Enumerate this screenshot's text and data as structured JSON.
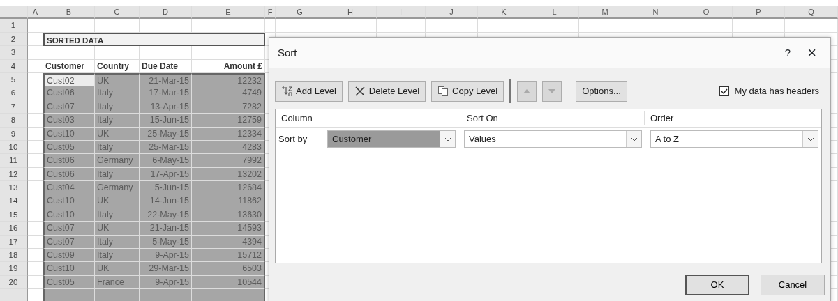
{
  "sheet": {
    "column_headers": [
      "A",
      "B",
      "C",
      "D",
      "E",
      "F",
      "G",
      "H",
      "I",
      "J",
      "K",
      "L",
      "M",
      "N",
      "O",
      "P",
      "Q"
    ],
    "row_numbers": [
      "1",
      "2",
      "3",
      "4",
      "5",
      "6",
      "7",
      "8",
      "9",
      "10",
      "11",
      "12",
      "13",
      "14",
      "15",
      "16",
      "17",
      "18",
      "19",
      "20"
    ],
    "title": "SORTED DATA",
    "table_headers": [
      "Customer",
      "Country",
      "Due Date",
      "Amount £"
    ],
    "rows": [
      {
        "customer": "Cust02",
        "country": "UK",
        "due_date": "21-Mar-15",
        "amount": "12232",
        "selected": true,
        "active": true
      },
      {
        "customer": "Cust06",
        "country": "Italy",
        "due_date": "17-Mar-15",
        "amount": "4749",
        "selected": true,
        "active": false
      },
      {
        "customer": "Cust07",
        "country": "Italy",
        "due_date": "13-Apr-15",
        "amount": "7282",
        "selected": true,
        "active": false
      },
      {
        "customer": "Cust03",
        "country": "Italy",
        "due_date": "15-Jun-15",
        "amount": "12759",
        "selected": true,
        "active": false
      },
      {
        "customer": "Cust10",
        "country": "UK",
        "due_date": "25-May-15",
        "amount": "12334",
        "selected": true,
        "active": false
      },
      {
        "customer": "Cust05",
        "country": "Italy",
        "due_date": "25-Mar-15",
        "amount": "4283",
        "selected": true,
        "active": false
      },
      {
        "customer": "Cust06",
        "country": "Germany",
        "due_date": "6-May-15",
        "amount": "7992",
        "selected": true,
        "active": false
      },
      {
        "customer": "Cust06",
        "country": "Italy",
        "due_date": "17-Apr-15",
        "amount": "13202",
        "selected": true,
        "active": false
      },
      {
        "customer": "Cust04",
        "country": "Germany",
        "due_date": "5-Jun-15",
        "amount": "12684",
        "selected": true,
        "active": false
      },
      {
        "customer": "Cust10",
        "country": "UK",
        "due_date": "14-Jun-15",
        "amount": "11862",
        "selected": true,
        "active": false
      },
      {
        "customer": "Cust10",
        "country": "Italy",
        "due_date": "22-May-15",
        "amount": "13630",
        "selected": true,
        "active": false
      },
      {
        "customer": "Cust07",
        "country": "UK",
        "due_date": "21-Jan-15",
        "amount": "14593",
        "selected": true,
        "active": false
      },
      {
        "customer": "Cust07",
        "country": "Italy",
        "due_date": "5-May-15",
        "amount": "4394",
        "selected": true,
        "active": false
      },
      {
        "customer": "Cust09",
        "country": "Italy",
        "due_date": "9-Apr-15",
        "amount": "15712",
        "selected": true,
        "active": false
      },
      {
        "customer": "Cust10",
        "country": "UK",
        "due_date": "29-Mar-15",
        "amount": "6503",
        "selected": true,
        "active": false
      },
      {
        "customer": "Cust05",
        "country": "France",
        "due_date": "9-Apr-15",
        "amount": "10544",
        "selected": true,
        "active": false
      }
    ]
  },
  "dialog": {
    "title": "Sort",
    "help": "?",
    "close": "×",
    "toolbar": [
      {
        "kind": "add",
        "key": "A",
        "post": "dd Level",
        "disabled": false
      },
      {
        "kind": "delete",
        "key": "D",
        "post": "elete Level",
        "disabled": false
      },
      {
        "kind": "copy",
        "key": "C",
        "post": "opy Level",
        "disabled": false
      },
      {
        "kind": "move_up",
        "disabled": true
      },
      {
        "kind": "move_down",
        "disabled": true
      },
      {
        "kind": "options",
        "key": "O",
        "post": "ptions...",
        "disabled": false
      }
    ],
    "headers_checkbox": {
      "pre": "My data has ",
      "key": "h",
      "post": "eaders",
      "checked": true
    },
    "grid_headers": [
      "Column",
      "Sort On",
      "Order"
    ],
    "levels": [
      {
        "label": "Sort by",
        "column": "Customer",
        "sort_on": "Values",
        "order": "A to Z",
        "selected": true
      }
    ],
    "buttons": [
      {
        "label": "OK",
        "default": true
      },
      {
        "label": "Cancel",
        "default": false
      }
    ]
  }
}
